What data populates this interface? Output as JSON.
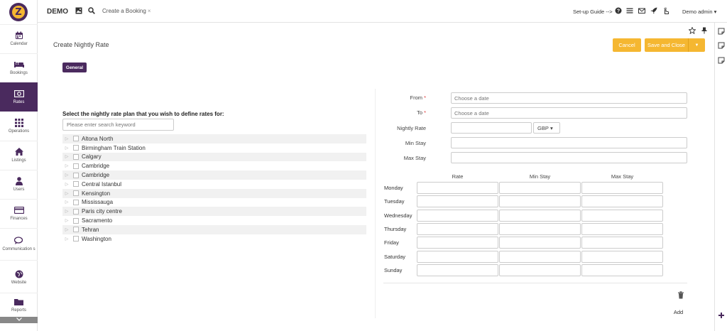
{
  "topbar": {
    "brand": "DEMO",
    "tab_label": "Create a Booking",
    "tab_close": "×",
    "setup_guide": "Set-up Guide -->",
    "user_name": "Demo admin"
  },
  "sidebar": {
    "items": [
      {
        "label": "Calendar",
        "icon": "calendar-icon"
      },
      {
        "label": "Bookings",
        "icon": "bed-icon"
      },
      {
        "label": "Rates",
        "icon": "money-icon"
      },
      {
        "label": "Operations",
        "icon": "grid-icon"
      },
      {
        "label": "Listings",
        "icon": "home-icon"
      },
      {
        "label": "Users",
        "icon": "user-icon"
      },
      {
        "label": "Finances",
        "icon": "credit-card-icon"
      },
      {
        "label": "Communication s",
        "icon": "chat-icon"
      },
      {
        "label": "Website",
        "icon": "globe-icon"
      },
      {
        "label": "Reports",
        "icon": "folder-icon"
      }
    ],
    "active_index": 2
  },
  "page": {
    "title": "Create Nightly Rate",
    "cancel_label": "Cancel",
    "save_label": "Save and Close",
    "general_tab": "General"
  },
  "selector": {
    "heading": "Select the nightly rate plan that you wish to define rates for:",
    "search_placeholder": "Please enter search keyword",
    "plans": [
      "Altona North",
      "Birmingham Train Station",
      "Calgary",
      "Cambridge",
      "Cambridge",
      "Central Istanbul",
      "Kensington",
      "Mississauga",
      "Paris city centre",
      "Sacramento",
      "Tehran",
      "Washington"
    ]
  },
  "form": {
    "from_label": "From",
    "to_label": "To",
    "required_mark": "*",
    "date_placeholder": "Choose a date",
    "nightly_rate_label": "Nightly Rate",
    "currency": "GBP",
    "min_stay_label": "Min Stay",
    "max_stay_label": "Max Stay"
  },
  "weekly": {
    "columns": [
      "Rate",
      "Min Stay",
      "Max Stay"
    ],
    "days": [
      "Monday",
      "Tuesday",
      "Wednesday",
      "Thursday",
      "Friday",
      "Saturday",
      "Sunday"
    ],
    "add_label": "Add"
  },
  "colors": {
    "brand_purple": "#4a2a5e",
    "accent_yellow": "#f5b731"
  }
}
